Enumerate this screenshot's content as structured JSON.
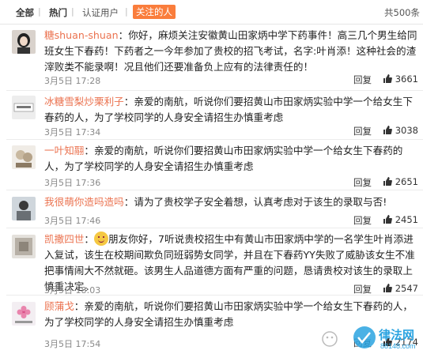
{
  "tabs": {
    "all": "全部",
    "hot": "热门",
    "verified": "认证用户",
    "following": "关注的人",
    "total": "共500条"
  },
  "comments": [
    {
      "username": "糖shuan-shuan",
      "text": "：你好，麻烦关注安徽黄山田家炳中学下药事件！高三几个男生给同班女生下春药！下药者之一今年参加了贵校的招飞考试，名字:叶肖添！这种社会的渣滓败类不能录啊！况且他们还要准备负上应有的法律责任的！",
      "date": "3月5日 17:28",
      "reply": "回复",
      "likes": "3661"
    },
    {
      "username": "冰糖雪梨炒栗利子",
      "text": "：亲爱的南航，听说你们要招黄山市田家炳实验中学一个给女生下春药的人，为了学校同学的人身安全请招生办慎重考虑",
      "date": "3月5日 17:34",
      "reply": "回复",
      "likes": "3038"
    },
    {
      "username": "一叶知翮",
      "text": "：亲爱的南航，听说你们要招黄山市田家炳实验中学一个给女生下春药的人，为了学校同学的人身安全请招生办慎重考虑",
      "date": "3月5日 17:36",
      "reply": "回复",
      "likes": "2651"
    },
    {
      "username": "我很萌你造吗造吗",
      "text": "：请为了贵校学子安全着想，认真考虑对于该生的录取与否!",
      "date": "3月5日 17:46",
      "reply": "回复",
      "likes": "2451"
    },
    {
      "username": "凯撒四世",
      "text": "朋友你好，7听说贵校招生中有黄山市田家炳中学的一名学生叶肖添进入复试，该生在校期间欺负同班弱势女同学，并且在下春药YY失败了威胁该女生不准把事情闹大不然就砸。该男生人品道德方面有严重的问题，恳请贵校对该生的录取上慎重决定。",
      "date": "3月5日 18:03",
      "reply": "回复",
      "likes": "2547"
    },
    {
      "username": "顾蒲戈",
      "text": "：亲爱的南航，听说你们要招黄山市田家炳实验中学一个给女生下春药的人，为了学校同学的人身安全请招生办慎重考虑",
      "date": "3月5日 17:54",
      "reply": "回复",
      "likes": "2174"
    }
  ],
  "watermark": {
    "brand": "律法网",
    "url": "88148.com"
  },
  "colors": {
    "accent": "#fa7d3c",
    "username": "#eb7350",
    "watermark": "#2aa3e0"
  }
}
